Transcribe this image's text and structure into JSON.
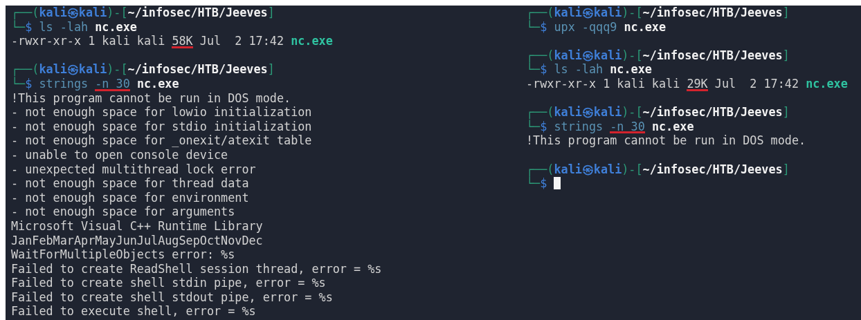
{
  "panes": [
    {
      "blocks": [
        {
          "prompt_top": [
            {
              "text": "┌──(",
              "kind": "frame"
            },
            {
              "text": "kali㉿kali",
              "kind": "user"
            },
            {
              "text": ")-[",
              "kind": "frame"
            },
            {
              "text": "~/infosec/HTB/Jeeves",
              "kind": "path"
            },
            {
              "text": "]",
              "kind": "frame"
            }
          ],
          "prompt_bottom": [
            {
              "text": "└─",
              "kind": "frame"
            },
            {
              "text": "$",
              "kind": "sigil"
            }
          ],
          "command": [
            {
              "text": "ls -lah",
              "kind": "cmd",
              "underlined": false
            },
            {
              "text": "nc.exe",
              "kind": "file",
              "underlined": false
            }
          ],
          "cursor": false,
          "output": [
            [
              {
                "text": "-rwxr-xr-x 1 kali kali",
                "kind": "out",
                "underlined": false
              },
              {
                "text": "58K",
                "kind": "out",
                "underlined": true
              },
              {
                "text": "Jul  2 17:42",
                "kind": "out",
                "underlined": false
              },
              {
                "text": "nc.exe",
                "kind": "exe",
                "underlined": false
              }
            ]
          ]
        },
        {
          "prompt_top": [
            {
              "text": "┌──(",
              "kind": "frame"
            },
            {
              "text": "kali㉿kali",
              "kind": "user"
            },
            {
              "text": ")-[",
              "kind": "frame"
            },
            {
              "text": "~/infosec/HTB/Jeeves",
              "kind": "path"
            },
            {
              "text": "]",
              "kind": "frame"
            }
          ],
          "prompt_bottom": [
            {
              "text": "└─",
              "kind": "frame"
            },
            {
              "text": "$",
              "kind": "sigil"
            }
          ],
          "command": [
            {
              "text": "strings",
              "kind": "cmd",
              "underlined": false
            },
            {
              "text": "-n 30",
              "kind": "cmd",
              "underlined": true
            },
            {
              "text": "nc.exe",
              "kind": "file",
              "underlined": false
            }
          ],
          "cursor": false,
          "output": [
            [
              {
                "text": "!This program cannot be run in DOS mode.",
                "kind": "out",
                "underlined": false
              }
            ],
            [
              {
                "text": "- not enough space for lowio initialization",
                "kind": "out",
                "underlined": false
              }
            ],
            [
              {
                "text": "- not enough space for stdio initialization",
                "kind": "out",
                "underlined": false
              }
            ],
            [
              {
                "text": "- not enough space for _onexit/atexit table",
                "kind": "out",
                "underlined": false
              }
            ],
            [
              {
                "text": "- unable to open console device",
                "kind": "out",
                "underlined": false
              }
            ],
            [
              {
                "text": "- unexpected multithread lock error",
                "kind": "out",
                "underlined": false
              }
            ],
            [
              {
                "text": "- not enough space for thread data",
                "kind": "out",
                "underlined": false
              }
            ],
            [
              {
                "text": "- not enough space for environment",
                "kind": "out",
                "underlined": false
              }
            ],
            [
              {
                "text": "- not enough space for arguments",
                "kind": "out",
                "underlined": false
              }
            ],
            [
              {
                "text": "Microsoft Visual C++ Runtime Library",
                "kind": "out",
                "underlined": false
              }
            ],
            [
              {
                "text": "JanFebMarAprMayJunJulAugSepOctNovDec",
                "kind": "out",
                "underlined": false
              }
            ],
            [
              {
                "text": "WaitForMultipleObjects error: %s",
                "kind": "out",
                "underlined": false
              }
            ],
            [
              {
                "text": "Failed to create ReadShell session thread, error = %s",
                "kind": "out",
                "underlined": false
              }
            ],
            [
              {
                "text": "Failed to create shell stdin pipe, error = %s",
                "kind": "out",
                "underlined": false
              }
            ],
            [
              {
                "text": "Failed to create shell stdout pipe, error = %s",
                "kind": "out",
                "underlined": false
              }
            ],
            [
              {
                "text": "Failed to execute shell, error = %s",
                "kind": "out",
                "underlined": false
              }
            ]
          ]
        }
      ]
    },
    {
      "blocks": [
        {
          "prompt_top": [
            {
              "text": "┌──(",
              "kind": "frame"
            },
            {
              "text": "kali㉿kali",
              "kind": "user"
            },
            {
              "text": ")-[",
              "kind": "frame"
            },
            {
              "text": "~/infosec/HTB/Jeeves",
              "kind": "path"
            },
            {
              "text": "]",
              "kind": "frame"
            }
          ],
          "prompt_bottom": [
            {
              "text": "└─",
              "kind": "frame"
            },
            {
              "text": "$",
              "kind": "sigil"
            }
          ],
          "command": [
            {
              "text": "upx -qqq9",
              "kind": "cmd",
              "underlined": false
            },
            {
              "text": "nc.exe",
              "kind": "file",
              "underlined": false
            }
          ],
          "cursor": false
        },
        {
          "prompt_top": [
            {
              "text": "┌──(",
              "kind": "frame"
            },
            {
              "text": "kali㉿kali",
              "kind": "user"
            },
            {
              "text": ")-[",
              "kind": "frame"
            },
            {
              "text": "~/infosec/HTB/Jeeves",
              "kind": "path"
            },
            {
              "text": "]",
              "kind": "frame"
            }
          ],
          "prompt_bottom": [
            {
              "text": "└─",
              "kind": "frame"
            },
            {
              "text": "$",
              "kind": "sigil"
            }
          ],
          "command": [
            {
              "text": "ls -lah",
              "kind": "cmd",
              "underlined": false
            },
            {
              "text": "nc.exe",
              "kind": "file",
              "underlined": false
            }
          ],
          "cursor": false,
          "output": [
            [
              {
                "text": "-rwxr-xr-x 1 kali kali",
                "kind": "out",
                "underlined": false
              },
              {
                "text": "29K",
                "kind": "out",
                "underlined": true
              },
              {
                "text": "Jul  2 17:42",
                "kind": "out",
                "underlined": false
              },
              {
                "text": "nc.exe",
                "kind": "exe",
                "underlined": false
              }
            ]
          ]
        },
        {
          "prompt_top": [
            {
              "text": "┌──(",
              "kind": "frame"
            },
            {
              "text": "kali㉿kali",
              "kind": "user"
            },
            {
              "text": ")-[",
              "kind": "frame"
            },
            {
              "text": "~/infosec/HTB/Jeeves",
              "kind": "path"
            },
            {
              "text": "]",
              "kind": "frame"
            }
          ],
          "prompt_bottom": [
            {
              "text": "└─",
              "kind": "frame"
            },
            {
              "text": "$",
              "kind": "sigil"
            }
          ],
          "command": [
            {
              "text": "strings",
              "kind": "cmd",
              "underlined": false
            },
            {
              "text": "-n 30",
              "kind": "cmd",
              "underlined": true
            },
            {
              "text": "nc.exe",
              "kind": "file",
              "underlined": false
            }
          ],
          "cursor": false,
          "output": [
            [
              {
                "text": "!This program cannot be run in DOS mode.",
                "kind": "out",
                "underlined": false
              }
            ]
          ]
        },
        {
          "prompt_top": [
            {
              "text": "┌──(",
              "kind": "frame"
            },
            {
              "text": "kali㉿kali",
              "kind": "user"
            },
            {
              "text": ")-[",
              "kind": "frame"
            },
            {
              "text": "~/infosec/HTB/Jeeves",
              "kind": "path"
            },
            {
              "text": "]",
              "kind": "frame"
            }
          ],
          "prompt_bottom": [
            {
              "text": "└─",
              "kind": "frame"
            },
            {
              "text": "$",
              "kind": "sigil"
            }
          ],
          "cursor": true
        }
      ]
    }
  ]
}
